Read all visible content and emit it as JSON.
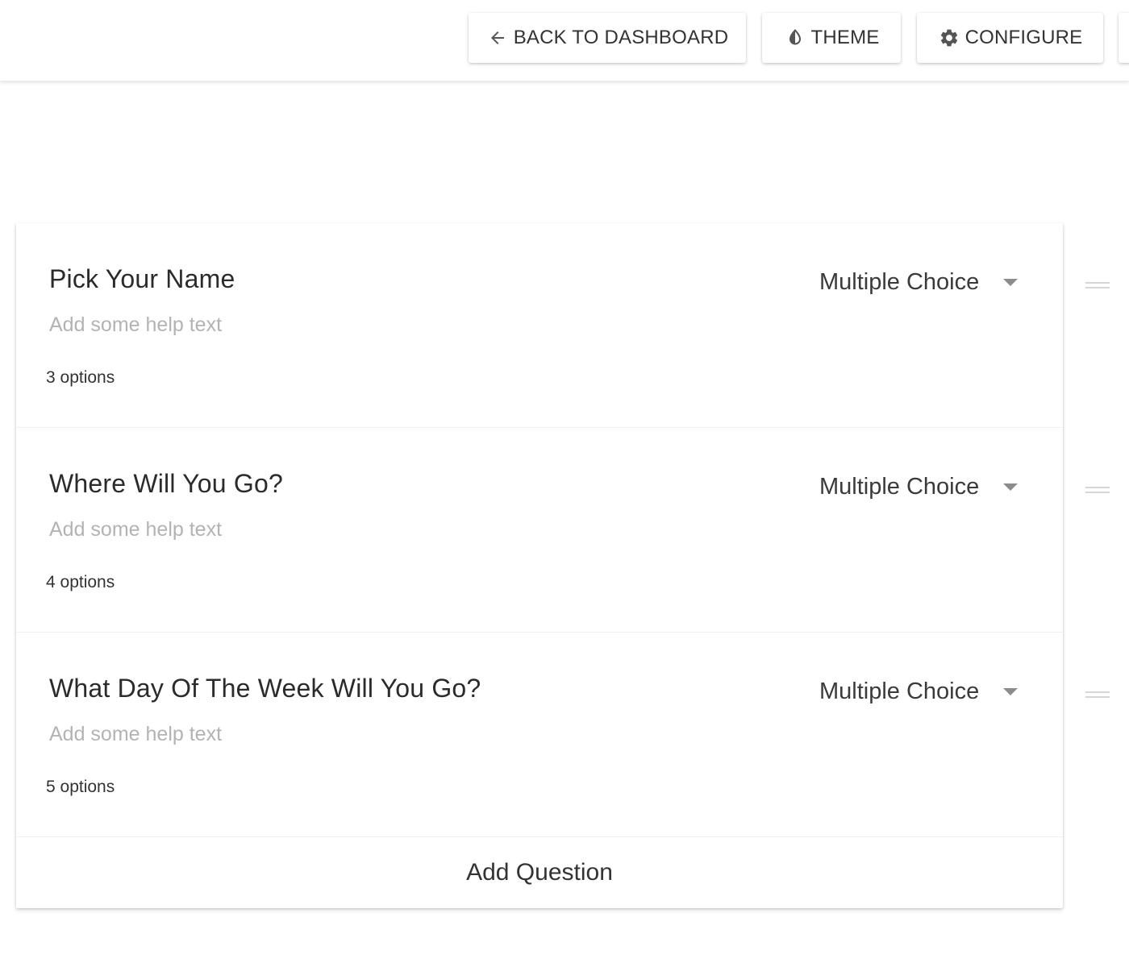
{
  "toolbar": {
    "back_label": "BACK TO DASHBOARD",
    "theme_label": "THEME",
    "configure_label": "CONFIGURE",
    "icons": {
      "back": "arrow-left-icon",
      "theme": "contrast-drop-icon",
      "configure": "gear-icon"
    }
  },
  "questions": [
    {
      "title": "Pick Your Name",
      "help_placeholder": "Add some help text",
      "options_count": "3 options",
      "type": "Multiple Choice"
    },
    {
      "title": "Where Will You Go?",
      "help_placeholder": "Add some help text",
      "options_count": "4 options",
      "type": "Multiple Choice"
    },
    {
      "title": "What Day Of The Week Will You Go?",
      "help_placeholder": "Add some help text",
      "options_count": "5 options",
      "type": "Multiple Choice"
    }
  ],
  "add_question_label": "Add Question",
  "colors": {
    "text_primary": "#2b2b2b",
    "help_text": "#b3b3b3",
    "caret": "#8c8c8c"
  }
}
